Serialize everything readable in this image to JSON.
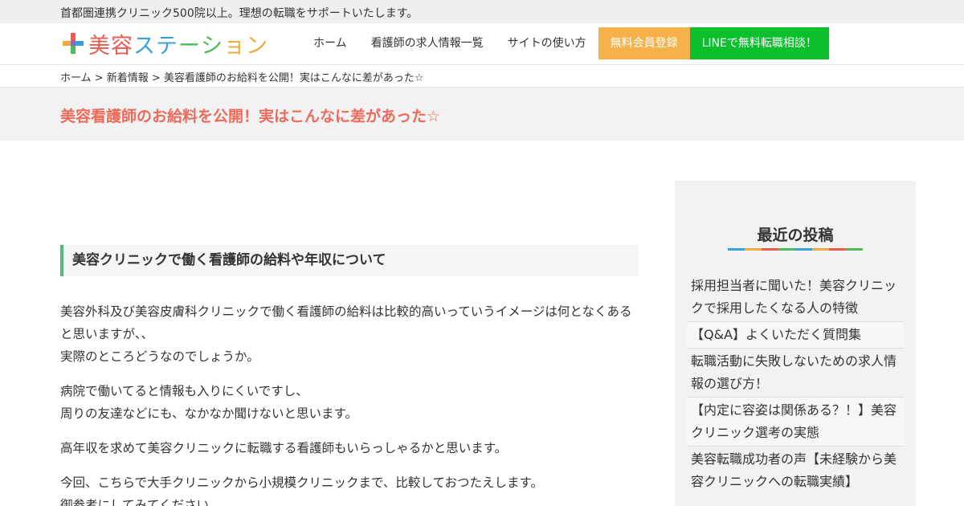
{
  "topbar": {
    "text": "首都圏連携クリニック500院以上。理想の転職をサポートいたします。"
  },
  "logo": {
    "chars": [
      {
        "ch": "美",
        "color": "#e85b4e"
      },
      {
        "ch": "容",
        "color": "#e85b4e"
      },
      {
        "ch": "ス",
        "color": "#3aa0dc"
      },
      {
        "ch": "テ",
        "color": "#3aa0dc"
      },
      {
        "ch": "ー",
        "color": "#4dbb5a"
      },
      {
        "ch": "シ",
        "color": "#4dbb5a"
      },
      {
        "ch": "ョ",
        "color": "#f2a93b"
      },
      {
        "ch": "ン",
        "color": "#f2a93b"
      }
    ]
  },
  "nav": {
    "home": "ホーム",
    "jobs": "看護師の求人情報一覧",
    "howto": "サイトの使い方",
    "register": "無料会員登録",
    "line": "LINEで無料転職相談！"
  },
  "breadcrumb": {
    "text": "ホーム > 新着情報 > 美容看護師のお給料を公開！実はこんなに差があった☆"
  },
  "page": {
    "title": "美容看護師のお給料を公開！実はこんなに差があった☆"
  },
  "article": {
    "heading": "美容クリニックで働く看護師の給料や年収について",
    "p1a": "美容外科及び美容皮膚科クリニックで働く看護師の給料は比較的高いっていうイメージは何となくあると思いますが、、",
    "p1b": "実際のところどうなのでしょうか。",
    "p2a": "病院で働いてると情報も入りにくいですし、",
    "p2b": "周りの友達などにも、なかなか聞けないと思います。",
    "p3": "高年収を求めて美容クリニックに転職する看護師もいらっしゃるかと思います。",
    "p4a": "今回、こちらで大手クリニックから小規模クリニックまで、比較しておつたえします。",
    "p4b": "御参考にしてみてください。"
  },
  "sidebar": {
    "title": "最近の投稿",
    "underline_colors": [
      "#3aa0dc",
      "#f2a93b",
      "#e85b4e",
      "#4dbb5a",
      "#3aa0dc",
      "#f2a93b",
      "#e85b4e",
      "#4dbb5a"
    ],
    "posts": [
      "採用担当者に聞いた！美容クリニックで採用したくなる人の特徴",
      "【Q&A】よくいただく質問集",
      "転職活動に失敗しないための求人情報の選び方！",
      "【内定に容姿は関係ある？！】美容クリニック選考の実態",
      "美容転職成功者の声【未経験から美容クリニックへの転職実績】"
    ]
  }
}
